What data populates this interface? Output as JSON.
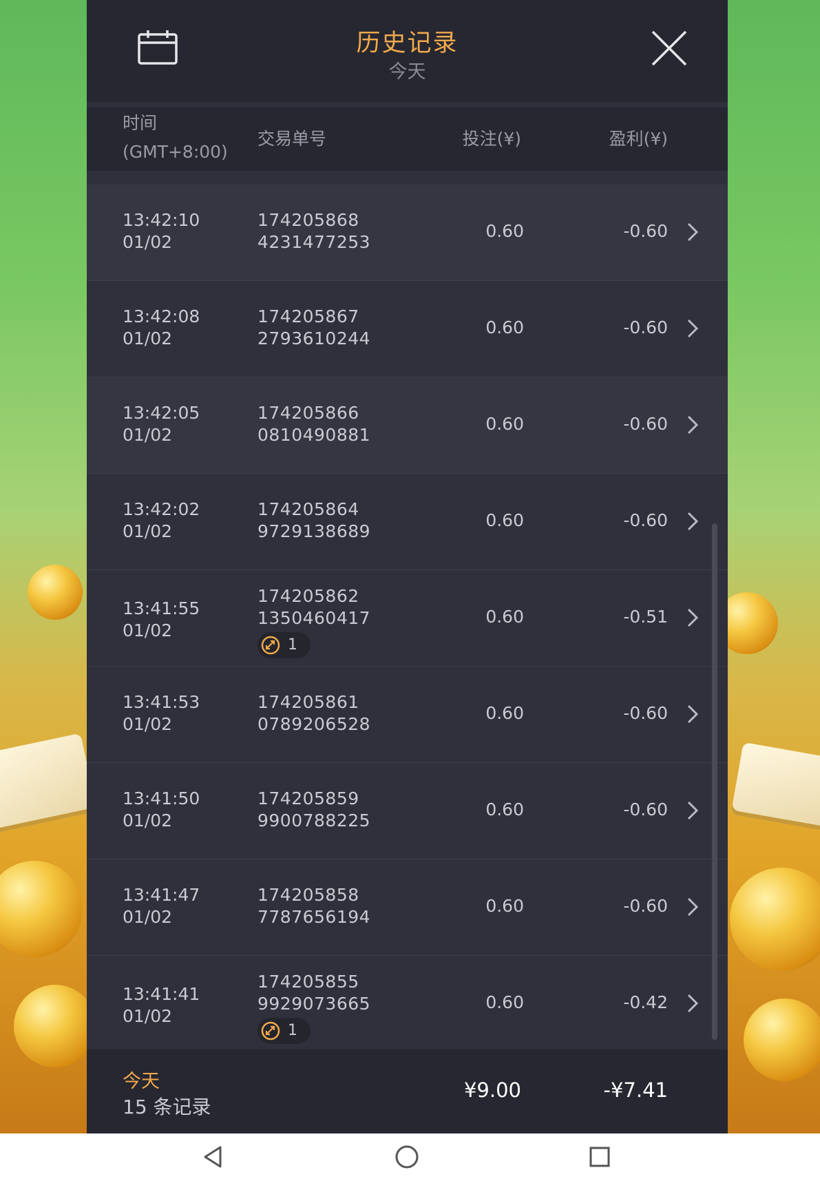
{
  "header": {
    "title": "历史记录",
    "subtitle": "今天"
  },
  "columns": {
    "time_line1": "时间",
    "time_line2": "(GMT+8:00)",
    "txid": "交易单号",
    "bet": "投注(¥)",
    "profit": "盈利(¥)"
  },
  "rows": [
    {
      "time": "13:42:10",
      "date": "01/02",
      "txid_a": "174205868",
      "txid_b": "4231477253",
      "bet": "0.60",
      "profit": "-0.60"
    },
    {
      "time": "13:42:08",
      "date": "01/02",
      "txid_a": "174205867",
      "txid_b": "2793610244",
      "bet": "0.60",
      "profit": "-0.60"
    },
    {
      "time": "13:42:05",
      "date": "01/02",
      "txid_a": "174205866",
      "txid_b": "0810490881",
      "bet": "0.60",
      "profit": "-0.60"
    },
    {
      "time": "13:42:02",
      "date": "01/02",
      "txid_a": "174205864",
      "txid_b": "9729138689",
      "bet": "0.60",
      "profit": "-0.60"
    },
    {
      "time": "13:41:55",
      "date": "01/02",
      "txid_a": "174205862",
      "txid_b": "1350460417",
      "bet": "0.60",
      "profit": "-0.51",
      "badge": "1"
    },
    {
      "time": "13:41:53",
      "date": "01/02",
      "txid_a": "174205861",
      "txid_b": "0789206528",
      "bet": "0.60",
      "profit": "-0.60"
    },
    {
      "time": "13:41:50",
      "date": "01/02",
      "txid_a": "174205859",
      "txid_b": "9900788225",
      "bet": "0.60",
      "profit": "-0.60"
    },
    {
      "time": "13:41:47",
      "date": "01/02",
      "txid_a": "174205858",
      "txid_b": "7787656194",
      "bet": "0.60",
      "profit": "-0.60"
    },
    {
      "time": "13:41:41",
      "date": "01/02",
      "txid_a": "174205855",
      "txid_b": "9929073665",
      "bet": "0.60",
      "profit": "-0.42",
      "badge": "1"
    }
  ],
  "footer": {
    "period": "今天",
    "count": "15 条记录",
    "total_bet": "¥9.00",
    "total_profit": "-¥7.41"
  },
  "icons": {
    "calendar": "calendar-icon",
    "close": "close-icon",
    "chevron": "chevron-right-icon",
    "feature": "free-spin-icon",
    "nav_back": "back-triangle-icon",
    "nav_home": "home-circle-icon",
    "nav_recent": "recent-square-icon"
  },
  "colors": {
    "accent": "#f2a94a",
    "panel": "#2f303c",
    "header": "#262731"
  }
}
